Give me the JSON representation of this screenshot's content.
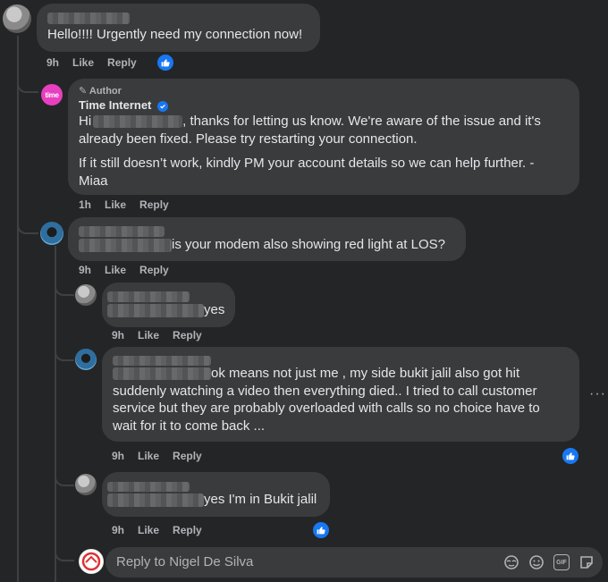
{
  "comments": [
    {
      "text": "Hello!!!! Urgently need my connection now!",
      "time": "9h",
      "like_label": "Like",
      "reply_label": "Reply"
    },
    {
      "author_badge": "Author",
      "name": "Time Internet",
      "avatar_text": "time",
      "text_prefix": "Hi",
      "text_line1_rest": ", thanks for letting us know. We're aware of the issue and it's",
      "text_line2": "already been fixed. Please try restarting your connection.",
      "text_para2_line1": "If it still doesn’t work, kindly PM your account details so we can help further. -",
      "text_para2_line2": "Miaa",
      "time": "1h",
      "like_label": "Like",
      "reply_label": "Reply"
    },
    {
      "text": "is your modem also showing red light at LOS?",
      "time": "9h",
      "like_label": "Like",
      "reply_label": "Reply"
    },
    {
      "text": "yes",
      "time": "9h",
      "like_label": "Like",
      "reply_label": "Reply"
    },
    {
      "text_line1": "ok means not just me , my side bukit jalil also got hit",
      "text_line2": "suddenly watching a video then everything died.. I tried to call customer",
      "text_line3": "service but they are probably overloaded with calls so no choice have to",
      "text_line4": "wait for it to come back ...",
      "time": "9h",
      "like_label": "Like",
      "reply_label": "Reply",
      "more_label": "···"
    },
    {
      "text": "yes I'm in Bukit jalil",
      "time": "9h",
      "like_label": "Like",
      "reply_label": "Reply"
    }
  ],
  "reply_box": {
    "placeholder": "Reply to Nigel De Silva",
    "icons": [
      "sticker-face-icon",
      "emoji-icon",
      "gif-icon",
      "sticker-icon"
    ],
    "gif_label": "GIF"
  },
  "colors": {
    "background": "#242526",
    "bubble": "#3a3b3c",
    "text": "#e4e6eb",
    "secondary_text": "#b0b3b8",
    "like_blue": "#1877f2",
    "time_brand": "#e83fbf"
  }
}
